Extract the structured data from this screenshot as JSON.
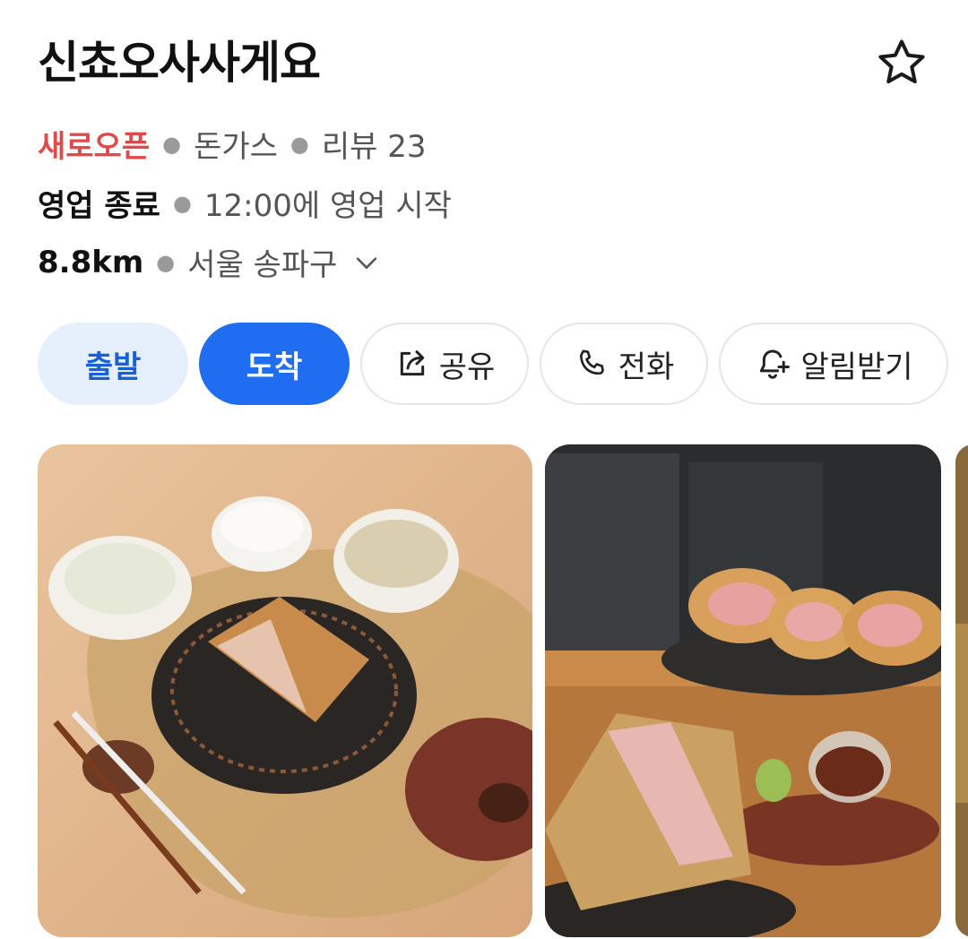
{
  "place": {
    "name": "신쵸오사사게요",
    "status_badge": "새로오픈",
    "category": "돈가스",
    "review_text": "리뷰 23",
    "hours_status": "영업 종료",
    "hours_info": "12:00에 영업 시작",
    "distance": "8.8km",
    "region": "서울 송파구"
  },
  "actions": {
    "start_label": "출발",
    "arrive_label": "도착",
    "share_label": "공유",
    "call_label": "전화",
    "alarm_label": "알림받기"
  },
  "icons": {
    "favorite": "star-outline-icon",
    "share": "share-icon",
    "call": "phone-icon",
    "alarm": "bell-plus-icon",
    "expand": "chevron-down-icon"
  },
  "colors": {
    "new_badge": "#e04a4a",
    "primary": "#1f6df0",
    "primary_light": "#e6f0fd"
  },
  "photos": [
    {
      "alt": "돈가스 정식 세트"
    },
    {
      "alt": "카운터 위 돈가스 요리"
    },
    {
      "alt": "음식 사진"
    }
  ]
}
